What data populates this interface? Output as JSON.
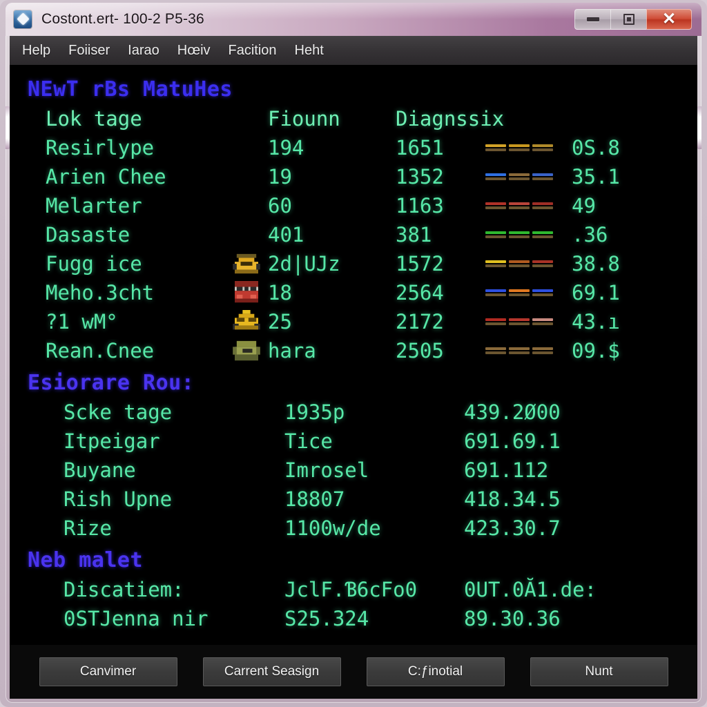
{
  "window": {
    "title": "Costont.ert- 100-2 P5-36",
    "app_icon": "diamond-gem-icon",
    "controls": {
      "minimize": "minimize-icon",
      "maximize": "maximize-icon",
      "close": "close-icon",
      "close_glyph": "✕"
    },
    "accent_color": "#a9789f",
    "close_color": "#cf4b35"
  },
  "menubar": {
    "items": [
      {
        "label": "Help"
      },
      {
        "label": "Foiiser"
      },
      {
        "label": "Iarao"
      },
      {
        "label": "Hœiv"
      },
      {
        "label": "Facition"
      },
      {
        "label": "Heht"
      }
    ]
  },
  "terminal": {
    "fg_color": "#57e8a8",
    "heading_color": "#3b2ef0",
    "bg_color": "#000000",
    "sections": [
      {
        "title": "NEwT rBs MatuHes",
        "header": {
          "name": "Lok tage",
          "v1": "Fiounn",
          "v2": "Diagnssix"
        },
        "rows": [
          {
            "name": "Resirlype",
            "icon": "",
            "v1": "194",
            "v2": "1651",
            "bars": [
              "#d2a227",
              "#c8981f",
              "#b08a2a"
            ],
            "v3": "0S.8"
          },
          {
            "name": "Arien Chee",
            "icon": "",
            "v1": "19",
            "v2": "1352",
            "bars": [
              "#2f6fe0",
              "#8a6a3a",
              "#3a63c8"
            ],
            "v3": "35.1"
          },
          {
            "name": "Melarter",
            "icon": "",
            "v1": "60",
            "v2": "1163",
            "bars": [
              "#b03228",
              "#b8443a",
              "#9e2e26"
            ],
            "v3": "49"
          },
          {
            "name": "Dasaste",
            "icon": "",
            "v1": "401",
            "v2": "381",
            "bars": [
              "#2fb82f",
              "#2fb82f",
              "#2fb82f"
            ],
            "v3": ".36"
          },
          {
            "name": "Fugg ice",
            "icon": "car-yellow-icon",
            "v1": "2d|UJz",
            "v2": "1572",
            "bars": [
              "#e0c020",
              "#b05a20",
              "#a83226"
            ],
            "v3": "38.8"
          },
          {
            "name": "Meho.3cht",
            "icon": "bus-red-icon",
            "v1": "18",
            "v2": "2564",
            "bars": [
              "#2d4fe0",
              "#e07820",
              "#2d4fe0"
            ],
            "v3": "69.1"
          },
          {
            "name": "?1 wM°",
            "icon": "taxi-yellow-icon",
            "v1": "25",
            "v2": "2172",
            "bars": [
              "#b22a22",
              "#b6362c",
              "#c98a80"
            ],
            "v3": "43.ı"
          },
          {
            "name": "Rean.Cnee",
            "icon": "tank-olive-icon",
            "v1": "hara",
            "v2": "2505",
            "bars": [
              "#8a6a3a",
              "#8a6a3a",
              "#8a6a3a"
            ],
            "v3": "09.$"
          }
        ]
      },
      {
        "title": "Esiorare Rou:",
        "rows": [
          {
            "name": "Scke tage",
            "a": "1935p",
            "b": "439.2Ø00"
          },
          {
            "name": "Itpeigar",
            "a": "Tice",
            "b": "691.69.1"
          },
          {
            "name": "Buyane",
            "a": "Imrosel",
            "b": "691.112"
          },
          {
            "name": "Rish Upne",
            "a": "18807",
            "b": "418.34.5"
          },
          {
            "name": "Rize",
            "a": "1100w/de",
            "b": "423.30.7"
          }
        ]
      },
      {
        "title": "Neb malet",
        "rows": [
          {
            "name": "Discatiem:",
            "a": "JclF.Ɓ6cFo0",
            "b": "0UT.0Ă1.de:"
          },
          {
            "name": "0STJenna nir",
            "a": "S25.324",
            "b": "89.30.36"
          }
        ]
      }
    ]
  },
  "footer": {
    "buttons": [
      {
        "label": "Canvimer"
      },
      {
        "label": "Carrent Seasign"
      },
      {
        "label": "C:ƒinotial"
      },
      {
        "label": "Nunt"
      }
    ]
  }
}
